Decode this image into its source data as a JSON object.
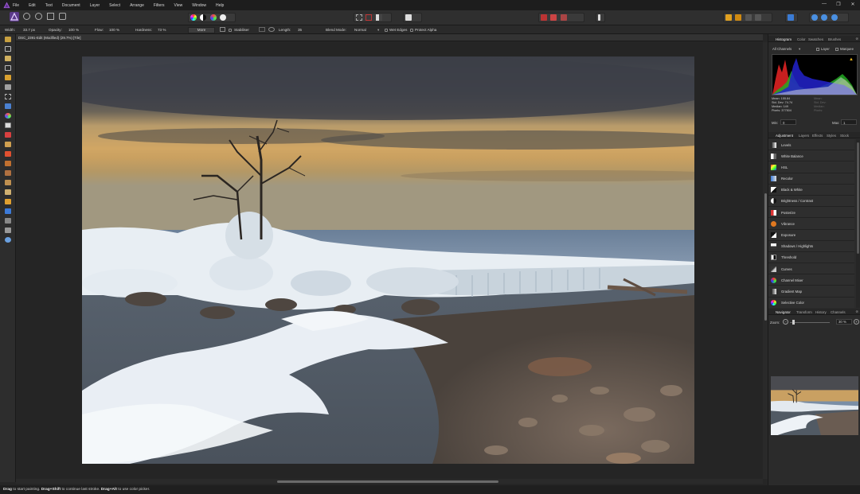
{
  "app": {
    "name": "Affinity Photo"
  },
  "menu": [
    "File",
    "Edit",
    "Text",
    "Document",
    "Layer",
    "Select",
    "Arrange",
    "Filters",
    "View",
    "Window",
    "Help"
  ],
  "window_controls": {
    "minimize": "—",
    "maximize": "❐",
    "close": "✕"
  },
  "context_bar": {
    "width_label": "Width:",
    "width_value": "33.7 px",
    "opacity_label": "Opacity:",
    "opacity_value": "100 %",
    "flow_label": "Flow:",
    "flow_value": "100 %",
    "hardness_label": "Hardness:",
    "hardness_value": "73 %",
    "more_label": "More",
    "stabiliser_label": "Stabiliser",
    "length_label": "Length:",
    "length_value": "35",
    "blend_mode_label": "Blend Mode:",
    "blend_mode_value": "Normal",
    "wet_edges_label": "Wet Edges",
    "protect_alpha_label": "Protect Alpha"
  },
  "document": {
    "tab_title": "DSC_2391-Edit (Modified) (29.7%) [Tile]"
  },
  "status_bar": {
    "drag1": "Drag",
    "text1": " to start painting. ",
    "drag2": "Drag+Shift",
    "text2": " to continue last stroke. ",
    "drag3": "Drag+Alt",
    "text3": " to use color picker."
  },
  "histogram_panel": {
    "tabs": [
      "Histogram",
      "Color",
      "Swatches",
      "Brushes"
    ],
    "active_tab": "Histogram",
    "channels_value": "All Channels",
    "layer_label": "Layer",
    "marquee_label": "Marquee",
    "stats_left": [
      "Mean: 155.84",
      "Std. Dev: 74.74",
      "Median: 149",
      "Pixels: 377504"
    ],
    "stats_right": [
      "Mean:",
      "Std. Dev:",
      "Median:",
      "Pixels:"
    ],
    "min_label": "Min:",
    "min_value": "0",
    "max_label": "Max:",
    "max_value": "1"
  },
  "adjustment_panel": {
    "tabs": [
      "Adjustment",
      "Layers",
      "Effects",
      "Styles",
      "Stock"
    ],
    "active_tab": "Adjustment",
    "items": [
      {
        "label": "Levels"
      },
      {
        "label": "White Balance"
      },
      {
        "label": "HSL"
      },
      {
        "label": "Recolor"
      },
      {
        "label": "Black & White"
      },
      {
        "label": "Brightness / Contrast"
      },
      {
        "label": "Posterize"
      },
      {
        "label": "Vibrance"
      },
      {
        "label": "Exposure"
      },
      {
        "label": "Shadows / Highlights"
      },
      {
        "label": "Threshold"
      },
      {
        "label": "Curves"
      },
      {
        "label": "Channel Mixer"
      },
      {
        "label": "Gradient Map"
      },
      {
        "label": "Selective Color"
      }
    ]
  },
  "navigator_panel": {
    "tabs": [
      "Navigator",
      "Transform",
      "History",
      "Channels"
    ],
    "active_tab": "Navigator",
    "zoom_label": "Zoom:",
    "zoom_value": "30 %"
  }
}
